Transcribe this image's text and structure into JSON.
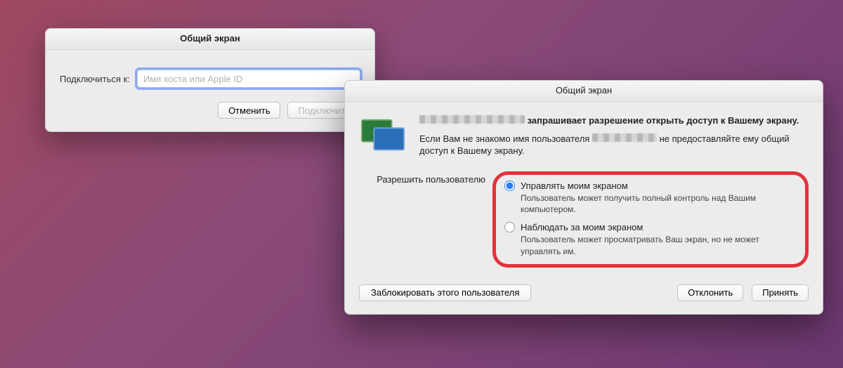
{
  "connect": {
    "title": "Общий экран",
    "label": "Подключиться к:",
    "placeholder": "Имя хоста или Apple ID",
    "cancel": "Отменить",
    "submit": "Подключить"
  },
  "perm": {
    "title": "Общий экран",
    "headline_suffix": "запрашивает разрешение открыть доступ к Вашему экрану.",
    "warn_prefix": "Если Вам не знакомо имя пользователя",
    "warn_suffix": "не предоставляйте ему общий доступ к Вашему экрану.",
    "allow_label": "Разрешить пользователю",
    "options": [
      {
        "title": "Управлять моим экраном",
        "desc": "Пользователь может получить полный контроль над Вашим компьютером.",
        "selected": true
      },
      {
        "title": "Наблюдать за моим экраном",
        "desc": "Пользователь может просматривать Ваш экран, но не может управлять им.",
        "selected": false
      }
    ],
    "block": "Заблокировать этого пользователя",
    "decline": "Отклонить",
    "accept": "Принять"
  }
}
